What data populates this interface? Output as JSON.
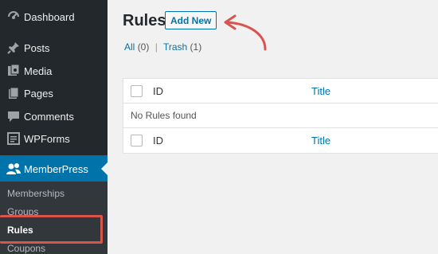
{
  "sidebar": {
    "items": [
      {
        "label": "Dashboard",
        "icon": "dashboard-icon"
      },
      {
        "label": "Posts",
        "icon": "pin-icon"
      },
      {
        "label": "Media",
        "icon": "media-icon"
      },
      {
        "label": "Pages",
        "icon": "pages-icon"
      },
      {
        "label": "Comments",
        "icon": "comments-icon"
      },
      {
        "label": "WPForms",
        "icon": "wpforms-icon"
      },
      {
        "label": "MemberPress",
        "icon": "members-icon"
      }
    ],
    "submenu": [
      "Memberships",
      "Groups",
      "Rules",
      "Coupons"
    ],
    "current_sub": "Rules"
  },
  "main": {
    "title": "Rules",
    "add_new_label": "Add New",
    "filters": {
      "all_label": "All",
      "all_count": "(0)",
      "trash_label": "Trash",
      "trash_count": "(1)"
    },
    "table": {
      "col_id": "ID",
      "col_title": "Title",
      "empty_message": "No Rules found"
    }
  },
  "colors": {
    "accent": "#0073aa",
    "sidebar_bg": "#23282d",
    "annotation": "#d9534f"
  }
}
